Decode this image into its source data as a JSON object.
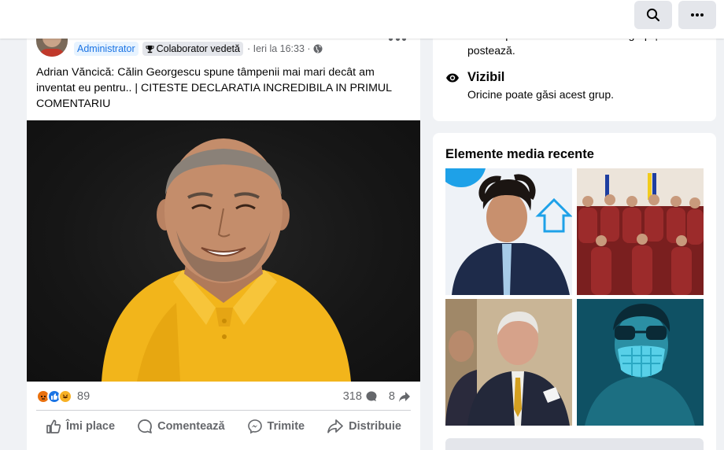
{
  "topbar": {
    "search_icon": "search-icon",
    "more_icon": "more-horizontal-icon"
  },
  "post": {
    "author_avatar": "avatar",
    "badge_admin": "Administrator",
    "badge_contributor": "Colaborator vedetă",
    "timestamp": "· Ieri la 16:33 ·",
    "privacy_icon": "globe-icon",
    "text": "Adrian Văncică: Călin Georgescu spune tâmpenii mai mari decât am inventat eu pentru.. | CITESTE DECLARATIA INCREDIBILA IN PRIMUL COMENTARIU",
    "reactions": {
      "icons": [
        "angry-react-icon",
        "like-react-icon",
        "haha-react-icon"
      ],
      "count": "89"
    },
    "comments_count": "318",
    "shares_count": "8",
    "actions": {
      "like": "Îmi place",
      "comment": "Comentează",
      "send": "Trimite",
      "share": "Distribuie"
    }
  },
  "about": {
    "partial_text": "Oricine poate vedea cine este în grup și ce postează.",
    "visible_title": "Vizibil",
    "visible_desc": "Oricine poate găsi acest grup."
  },
  "media": {
    "title": "Elemente media recente"
  },
  "colors": {
    "accent": "#1b74e4",
    "background": "#f0f2f5",
    "secondary_text": "#65676b"
  }
}
